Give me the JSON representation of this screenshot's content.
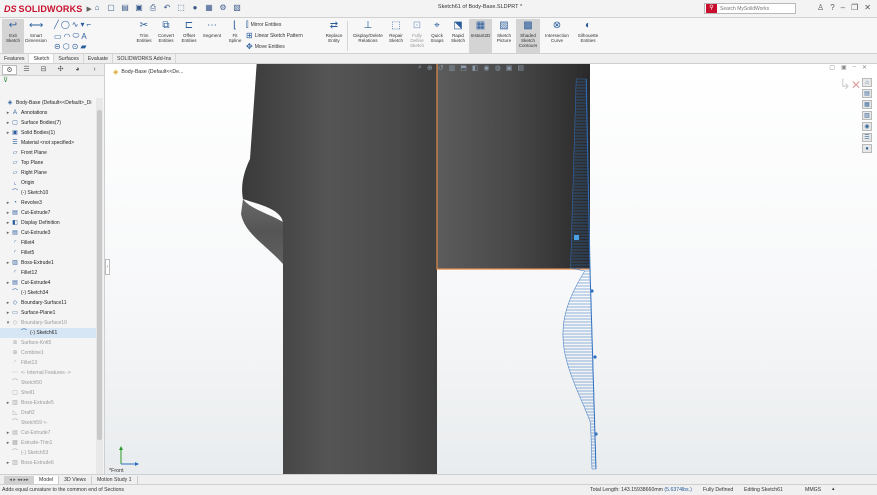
{
  "app": {
    "logo_ds": "DS",
    "logo_name": "SOLIDWORKS",
    "doc_title": "Sketch61 of Body-Base.SLDPRT *",
    "search_placeholder": "Search MySolidWorks"
  },
  "toolbar": {
    "tools": [
      {
        "id": "exit-sketch",
        "label": "Exit\nSketch",
        "icon": "exit-sketch-icon"
      },
      {
        "id": "smart-dimension",
        "label": "Smart\nDimension",
        "icon": "smart-dimension-icon"
      },
      {
        "id": "trim-entities",
        "label": "Trim\nEntities",
        "icon": "trim-icon"
      },
      {
        "id": "convert-entities",
        "label": "Convert\nEntities",
        "icon": "convert-icon"
      },
      {
        "id": "offset-entities",
        "label": "Offset\nEntities",
        "icon": "offset-icon"
      },
      {
        "id": "segment",
        "label": "Segment",
        "icon": "segment-icon"
      },
      {
        "id": "fit-spline",
        "label": "Fit\nSpline",
        "icon": "fit-spline-icon"
      },
      {
        "id": "replace-entity",
        "label": "Replace\nEntity",
        "icon": "replace-icon"
      },
      {
        "id": "display-delete-relations",
        "label": "Display/Delete\nRelations",
        "icon": "relations-icon"
      },
      {
        "id": "repair-sketch",
        "label": "Repair\nSketch",
        "icon": "repair-icon"
      },
      {
        "id": "fully-define-sketch",
        "label": "Fully\nDefine\nSketch",
        "icon": "fully-define-icon"
      },
      {
        "id": "quick-snaps",
        "label": "Quick\nSnaps",
        "icon": "quick-snaps-icon"
      },
      {
        "id": "rapid-sketch",
        "label": "Rapid\nSketch",
        "icon": "rapid-sketch-icon"
      },
      {
        "id": "instant2d",
        "label": "Instant2D",
        "icon": "instant2d-icon"
      },
      {
        "id": "sketch-picture",
        "label": "Sketch\nPicture",
        "icon": "sketch-picture-icon"
      },
      {
        "id": "shaded-sketch-contours",
        "label": "Shaded\nSketch\nContours",
        "icon": "shaded-contours-icon"
      },
      {
        "id": "intersection-curve",
        "label": "Intersection\nCurve",
        "icon": "intersection-curve-icon"
      },
      {
        "id": "silhouette-entities",
        "label": "Silhouette\nEntities",
        "icon": "silhouette-icon"
      }
    ],
    "mirror_entities": "Mirror Entities",
    "linear_sketch_pattern": "Linear Sketch Pattern",
    "move_entities": "Move Entities"
  },
  "tabs": [
    "Features",
    "Sketch",
    "Surfaces",
    "Evaluate",
    "SOLIDWORKS Add-Ins"
  ],
  "active_tab": "Sketch",
  "feature_tree": [
    {
      "label": "Body-Base  (Default<<Default>_Di",
      "icon": "part-icon",
      "exp": "",
      "state": "normal"
    },
    {
      "label": "Annotations",
      "icon": "annotations-icon",
      "exp": "▸",
      "state": "normal"
    },
    {
      "label": "Surface Bodies(7)",
      "icon": "surface-bodies-icon",
      "exp": "▸",
      "state": "normal"
    },
    {
      "label": "Solid Bodies(1)",
      "icon": "solid-bodies-icon",
      "exp": "▸",
      "state": "normal"
    },
    {
      "label": "Material <not specified>",
      "icon": "material-icon",
      "exp": "",
      "state": "normal"
    },
    {
      "label": "Front Plane",
      "icon": "plane-icon",
      "exp": "",
      "state": "normal"
    },
    {
      "label": "Top Plane",
      "icon": "plane-icon",
      "exp": "",
      "state": "normal"
    },
    {
      "label": "Right Plane",
      "icon": "plane-icon",
      "exp": "",
      "state": "normal"
    },
    {
      "label": "Origin",
      "icon": "origin-icon",
      "exp": "",
      "state": "normal"
    },
    {
      "label": "(-) Sketch10",
      "icon": "sketch-icon",
      "exp": "",
      "state": "normal"
    },
    {
      "label": "Revolve3",
      "icon": "revolve-icon",
      "exp": "▸",
      "state": "normal"
    },
    {
      "label": "Cut-Extrude7",
      "icon": "cut-extrude-icon",
      "exp": "▸",
      "state": "normal"
    },
    {
      "label": "Display Definition",
      "icon": "display-icon",
      "exp": "▸",
      "state": "normal"
    },
    {
      "label": "Cut-Extrude3",
      "icon": "cut-extrude-icon",
      "exp": "▸",
      "state": "normal"
    },
    {
      "label": "Fillet4",
      "icon": "fillet-icon",
      "exp": "",
      "state": "normal"
    },
    {
      "label": "Fillet5",
      "icon": "fillet-icon",
      "exp": "",
      "state": "normal"
    },
    {
      "label": "Boss-Extrude1",
      "icon": "boss-extrude-icon",
      "exp": "▸",
      "state": "normal"
    },
    {
      "label": "Fillet12",
      "icon": "fillet-icon",
      "exp": "",
      "state": "normal"
    },
    {
      "label": "Cut-Extrude4",
      "icon": "cut-extrude-icon",
      "exp": "▸",
      "state": "normal"
    },
    {
      "label": "(-) Sketch34",
      "icon": "sketch-icon",
      "exp": "",
      "state": "normal"
    },
    {
      "label": "Boundary-Surface11",
      "icon": "boundary-surface-icon",
      "exp": "▸",
      "state": "normal"
    },
    {
      "label": "Surface-Plane1",
      "icon": "surface-plane-icon",
      "exp": "▸",
      "state": "normal"
    },
    {
      "label": "Boundary-Surface10",
      "icon": "boundary-surface-icon",
      "exp": "▾",
      "state": "dim"
    },
    {
      "label": "(-) Sketch61",
      "icon": "sketch-icon",
      "exp": "",
      "state": "hl"
    },
    {
      "label": "Surface-Knit5",
      "icon": "surface-knit-icon",
      "exp": "",
      "state": "dim"
    },
    {
      "label": "Combine1",
      "icon": "combine-icon",
      "exp": "",
      "state": "dim"
    },
    {
      "label": "Fillet13",
      "icon": "fillet-icon",
      "exp": "",
      "state": "dim"
    },
    {
      "label": "<- Internal Features ->",
      "icon": "internal-icon",
      "exp": "",
      "state": "dim"
    },
    {
      "label": "Sketch50",
      "icon": "sketch-icon",
      "exp": "",
      "state": "dim"
    },
    {
      "label": "Shell1",
      "icon": "shell-icon",
      "exp": "",
      "state": "dim"
    },
    {
      "label": "Boss-Extrude5",
      "icon": "boss-extrude-icon",
      "exp": "▸",
      "state": "dim"
    },
    {
      "label": "Draft2",
      "icon": "draft-icon",
      "exp": "",
      "state": "dim"
    },
    {
      "label": "Sketch59 <-",
      "icon": "sketch-icon",
      "exp": "",
      "state": "dim"
    },
    {
      "label": "Cut-Extrude7",
      "icon": "cut-extrude-icon",
      "exp": "▸",
      "state": "dim"
    },
    {
      "label": "Extrude-Thin1",
      "icon": "extrude-thin-icon",
      "exp": "▸",
      "state": "dim"
    },
    {
      "label": "(-) Sketch53",
      "icon": "sketch-icon",
      "exp": "",
      "state": "dim"
    },
    {
      "label": "Boss-Extrude6",
      "icon": "boss-extrude-icon",
      "exp": "▸",
      "state": "dim"
    }
  ],
  "viewport": {
    "breadcrumb": "Body-Base  (Default<<De...",
    "view_name": "*Front"
  },
  "model_tabs": [
    "Model",
    "3D Views",
    "Motion Study 1"
  ],
  "active_model_tab": "Model",
  "status": {
    "hint": "Adds equal curvature to the common end of Sections",
    "total_length": "Total Length: 143.15938660mm",
    "angle": "(5.6374lbs.)",
    "defined": "Fully Defined",
    "editing": "Editing Sketch61",
    "units": "MMGS",
    "units_arrow": "▴"
  },
  "colors": {
    "accent_red": "#c8102e",
    "sketch_blue": "#2f6fc0",
    "highlight_orange": "#e08a4a"
  }
}
